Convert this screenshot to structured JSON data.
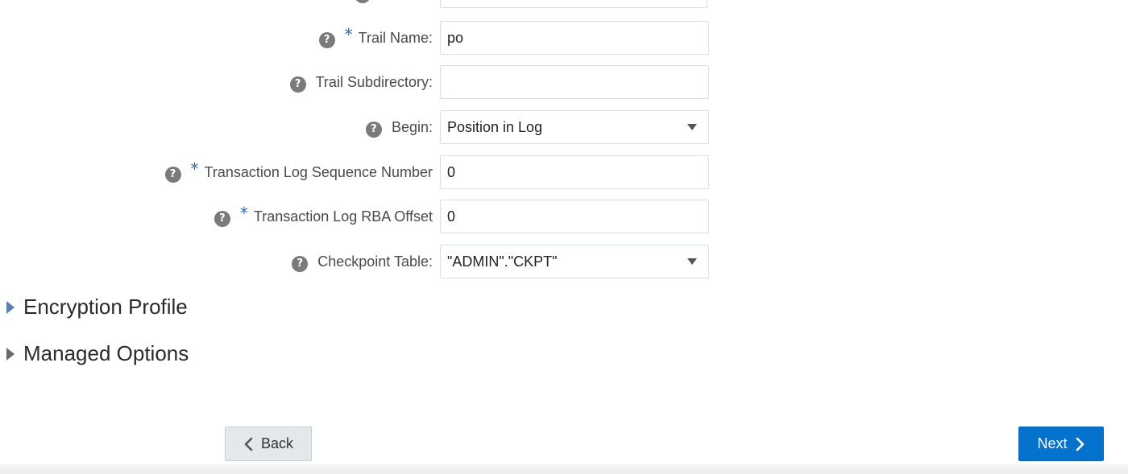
{
  "form": {
    "rows": [
      {
        "label": "Trail Name:",
        "required": true,
        "type": "text",
        "value": "po"
      },
      {
        "label": "Trail Subdirectory:",
        "required": false,
        "type": "text",
        "value": ""
      },
      {
        "label": "Begin:",
        "required": false,
        "type": "select",
        "value": "Position in Log"
      },
      {
        "label": "Transaction Log Sequence Number",
        "required": true,
        "type": "text",
        "value": "0"
      },
      {
        "label": "Transaction Log RBA Offset",
        "required": true,
        "type": "text",
        "value": "0"
      },
      {
        "label": "Checkpoint Table:",
        "required": false,
        "type": "select",
        "value": "\"ADMIN\".\"CKPT\""
      }
    ],
    "required_marker": "*",
    "help_glyph": "?"
  },
  "sections": {
    "encryption_profile": "Encryption Profile",
    "managed_options": "Managed Options"
  },
  "buttons": {
    "back_label": "Back",
    "next_label": "Next"
  },
  "colors": {
    "primary_button": "#0572ce",
    "required_star": "#2c6ba8",
    "help_icon": "#7a7a7a"
  },
  "icons": {
    "help": "help-icon",
    "dropdown": "caret-down-icon",
    "disclosure": "disclosure-triangle-icon",
    "back": "chevron-left-icon",
    "next": "chevron-right-icon"
  }
}
